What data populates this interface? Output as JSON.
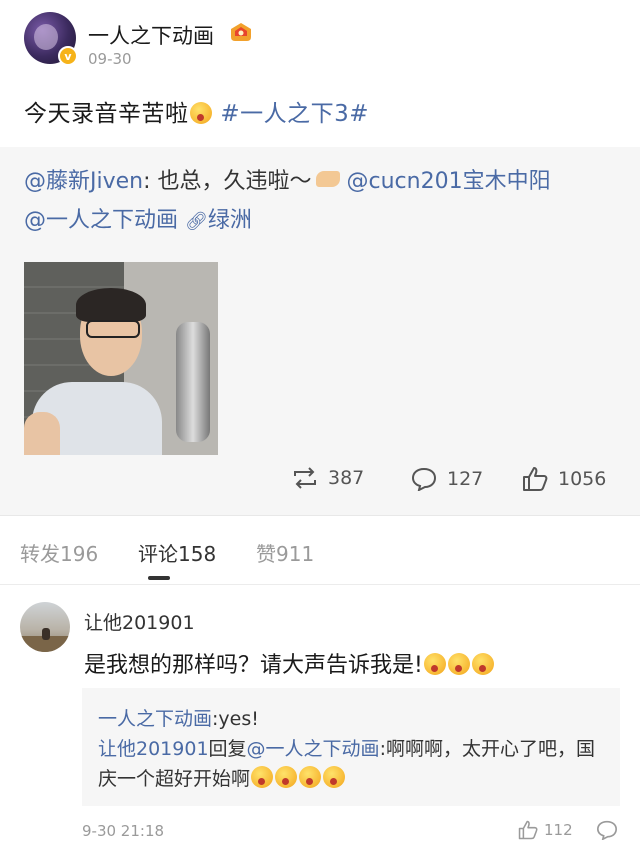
{
  "post": {
    "author": "一人之下动画",
    "date": "09-30",
    "text": "今天录音辛苦啦",
    "hashtag": "#一人之下3#"
  },
  "repost": {
    "mention_1": "@藤新Jiven",
    "text_1": ": 也总，久违啦～",
    "mention_2": "@cucn201宝木中阳",
    "mention_3": "@一人之下动画",
    "link_label": "绿洲",
    "stats": {
      "reposts": "387",
      "comments": "127",
      "likes": "1056"
    }
  },
  "tabs": {
    "repost": "转发196",
    "comments": "评论158",
    "likes": "赞911"
  },
  "comment": {
    "username": "让他201901",
    "text": "是我想的那样吗？请大声告诉我是!",
    "reply": {
      "user_1": "一人之下动画",
      "text_1": ":yes!",
      "user_2": "让他201901",
      "reply_word": "回复",
      "user_3": "@一人之下动画",
      "text_2": ":啊啊啊，太开心了吧，国庆一个超好开始啊"
    },
    "time": "9-30 21:18",
    "likes": "112"
  },
  "colors": {
    "link": "#4a6aa5",
    "muted": "#9a9a9a",
    "panel": "#f6f6f6",
    "verify": "#f6b319"
  },
  "icons": [
    "verified-icon",
    "vip-icon",
    "emoji-icon",
    "link-icon",
    "repost-icon",
    "comment-icon",
    "like-icon",
    "reply-icon"
  ]
}
